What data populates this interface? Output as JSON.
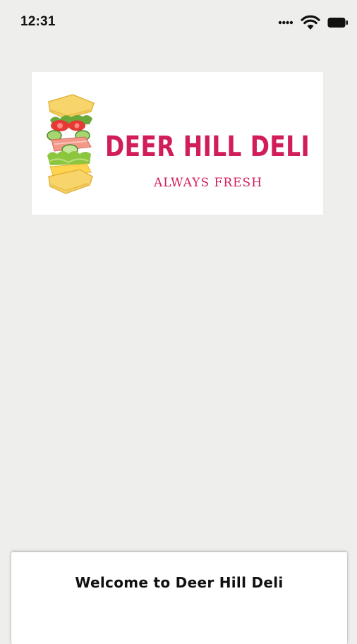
{
  "status_bar": {
    "time": "12:31",
    "icons": [
      "signal-dots-icon",
      "wifi-icon",
      "battery-icon"
    ]
  },
  "logo": {
    "name": "DEER HILL DELI",
    "tagline": "ALWAYS FRESH",
    "illustration": "sandwich-icon",
    "brand_color": "#d11d5a"
  },
  "welcome_sheet": {
    "text": "Welcome to Deer Hill Deli"
  },
  "colors": {
    "background": "#eeeeec",
    "card": "#ffffff"
  }
}
